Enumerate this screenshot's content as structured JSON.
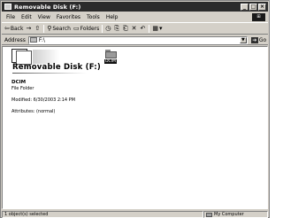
{
  "window": {
    "title": "Removable Disk (F:)",
    "controls": {
      "minimize": "_",
      "maximize": "□",
      "close": "×"
    }
  },
  "menu": {
    "items": [
      "File",
      "Edit",
      "View",
      "Favorites",
      "Tools",
      "Help"
    ]
  },
  "toolbar": {
    "back_label": "Back",
    "forward_glyph": "→",
    "search_label": "Search",
    "folders_label": "Folders",
    "views_glyph": "▦"
  },
  "address": {
    "label": "Address",
    "value": "F:\\",
    "go_label": "Go"
  },
  "content": {
    "heading": "Removable Disk (F:)",
    "folder_label": "DCIM",
    "details": {
      "name": "DCIM",
      "type": "File Folder",
      "modified": "Modified: 6/30/2003 2:14 PM",
      "attributes": "Attributes: (normal)"
    }
  },
  "statusbar": {
    "left": "1 object(s) selected",
    "right": "My Computer"
  },
  "colors": {
    "titlebar": "#2b2b2b",
    "chrome": "#d4d0c8",
    "content_bg": "#ffffff"
  }
}
